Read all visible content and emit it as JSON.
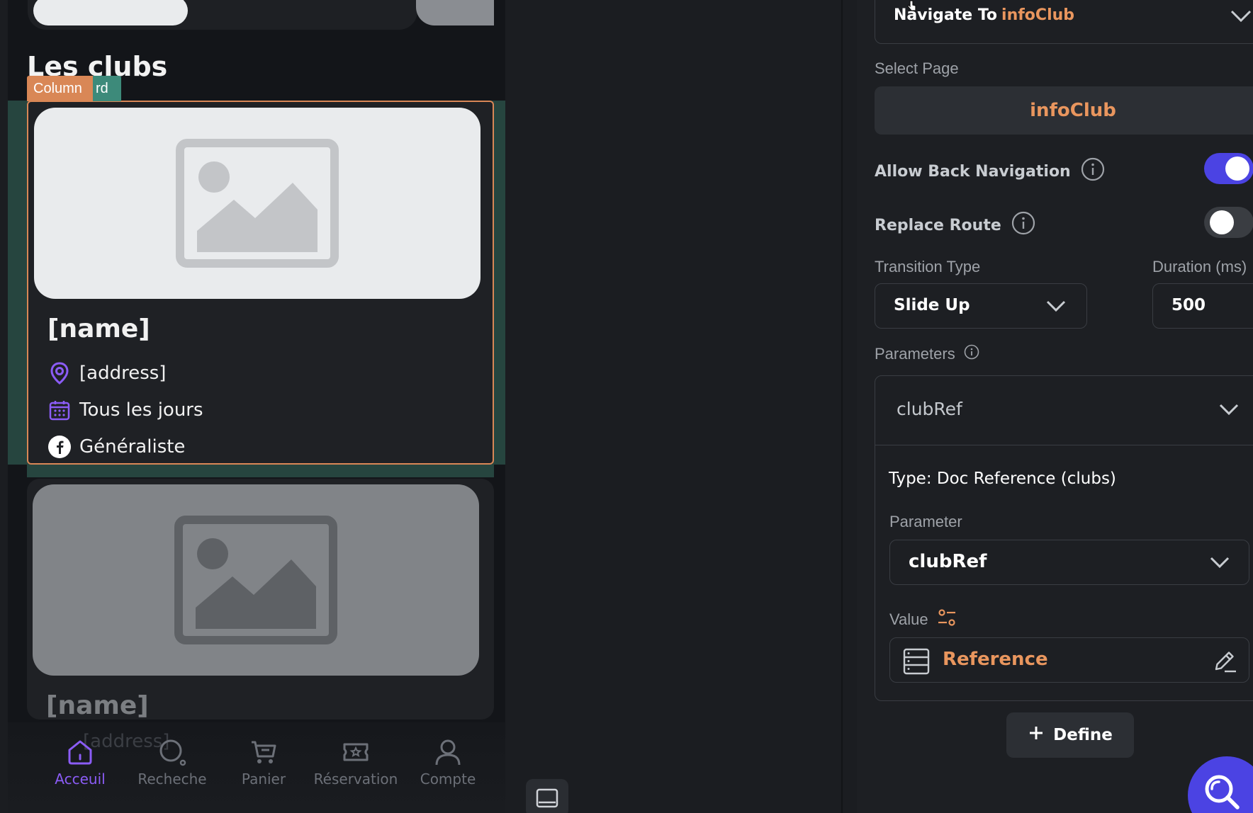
{
  "preview": {
    "section_title": "Les clubs",
    "tags": {
      "column": "Column",
      "card": "rd"
    },
    "cards": [
      {
        "name": "[name]",
        "address": "[address]",
        "schedule": "Tous les jours",
        "category": "Généraliste"
      },
      {
        "name": "[name]"
      }
    ],
    "nav_ghost_text": "[address]",
    "bottom_nav": [
      {
        "label": "Acceuil",
        "icon": "home-icon",
        "active": true
      },
      {
        "label": "Recheche",
        "icon": "search-icon"
      },
      {
        "label": "Panier",
        "icon": "cart-icon"
      },
      {
        "label": "Réservation",
        "icon": "ticket-icon"
      },
      {
        "label": "Compte",
        "icon": "user-icon"
      }
    ]
  },
  "panel": {
    "navigate_label": "Navigate To",
    "navigate_target": "infoClub",
    "select_page_label": "Select Page",
    "selected_page": "infoClub",
    "allow_back_label": "Allow Back Navigation",
    "allow_back_on": true,
    "replace_route_label": "Replace Route",
    "replace_route_on": false,
    "transition_label": "Transition Type",
    "transition_value": "Slide Up",
    "duration_label": "Duration (ms)",
    "duration_value": "500",
    "parameters_label": "Parameters",
    "param_name": "clubRef",
    "param_type": "Type: Doc Reference (clubs)",
    "parameter_label": "Parameter",
    "parameter_value": "clubRef",
    "value_label": "Value",
    "value_source": "Reference",
    "define_label": "Define"
  },
  "colors": {
    "accent_orange": "#e9965e",
    "accent_purple": "#4b43e3",
    "teal": "#26453f"
  }
}
